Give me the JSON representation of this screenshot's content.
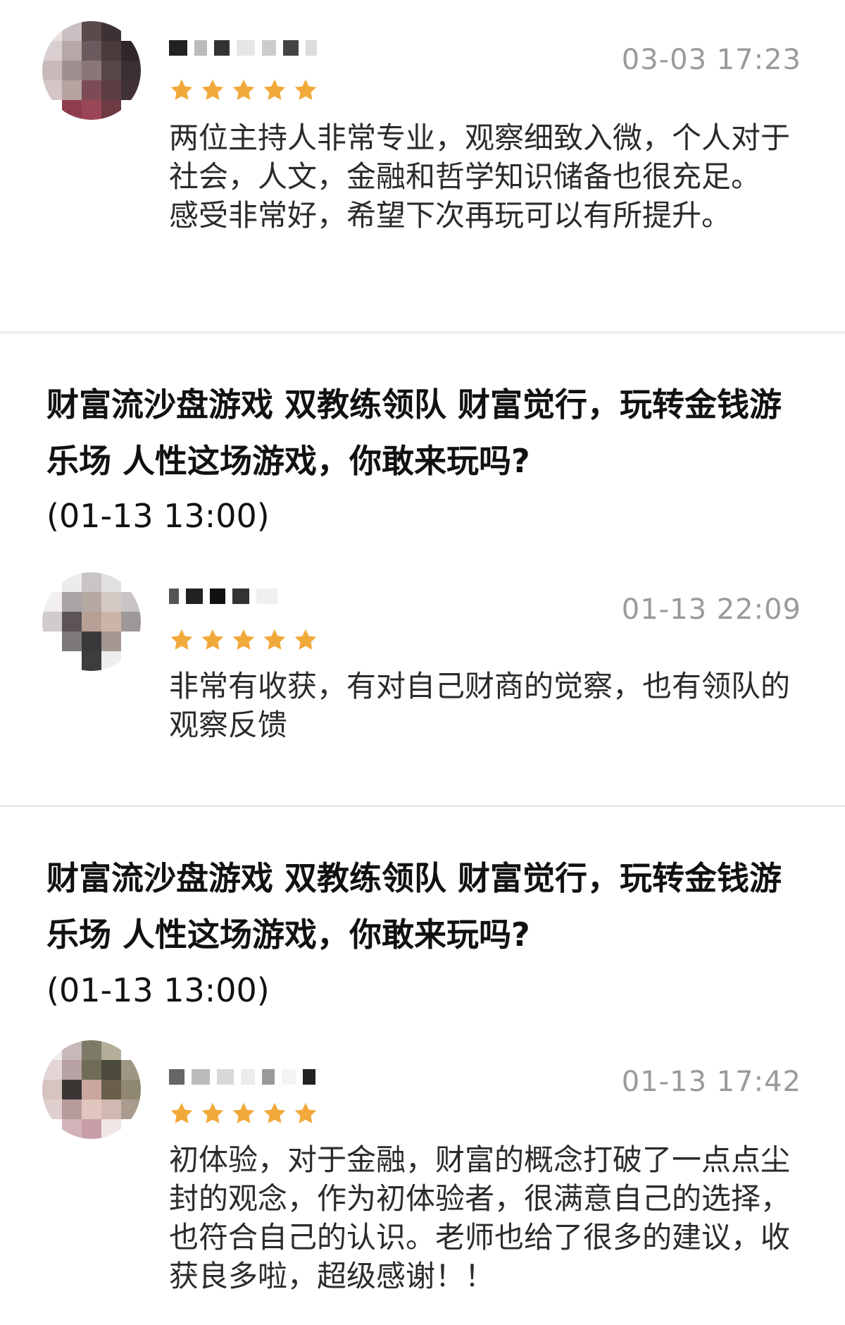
{
  "reviews": [
    {
      "timestamp": "03-03 17:23",
      "rating": 5,
      "text": "两位主持人非常专业，观察细致入微，个人对于社会，人文，金融和哲学知识储备也很充足。\n感受非常好，希望下次再玩可以有所提升。"
    },
    {
      "event_title": "财富流沙盘游戏 双教练领队 财富觉行，玩转金钱游乐场 人性这场游戏，你敢来玩吗?",
      "event_time": "(01-13 13:00)",
      "timestamp": "01-13 22:09",
      "rating": 5,
      "text": "非常有收获，有对自己财商的觉察，也有领队的观察反馈"
    },
    {
      "event_title": "财富流沙盘游戏 双教练领队 财富觉行，玩转金钱游乐场 人性这场游戏，你敢来玩吗?",
      "event_time": "(01-13 13:00)",
      "timestamp": "01-13 17:42",
      "rating": 5,
      "text": "初体验，对于金融，财富的概念打破了一点点尘封的观念，作为初体验者，很满意自己的选择，也符合自己的认识。老师也给了很多的建议，收获良多啦，超级感谢！！"
    }
  ],
  "colors": {
    "star": "#F2A93B",
    "timestamp": "#9a9a9a",
    "divider": "#ececec"
  },
  "icons": {
    "rating": "star-icon",
    "avatar": "avatar-pixelated"
  }
}
